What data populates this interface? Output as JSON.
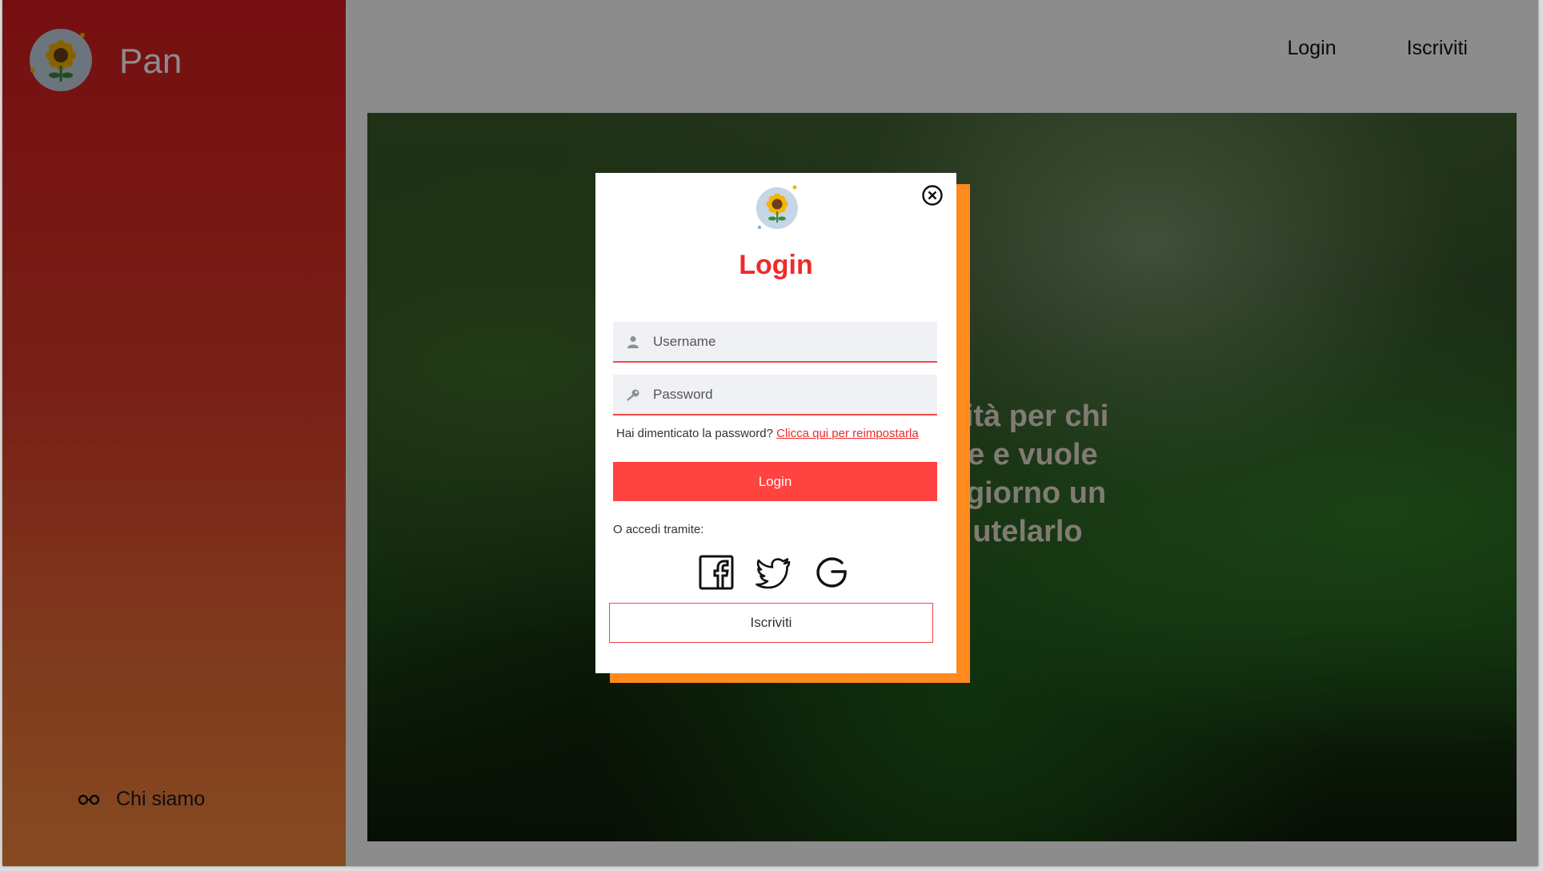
{
  "brand": {
    "name": "Pan",
    "logo_icon": "sunflower-icon"
  },
  "sidebar": {
    "about_label": "Chi siamo",
    "about_icon": "glasses-icon"
  },
  "topnav": {
    "login_label": "Login",
    "signup_label": "Iscriviti"
  },
  "hero": {
    "lines": [
      "nità per chi",
      "te e vuole",
      "i giorno un",
      "utelarlo"
    ]
  },
  "modal": {
    "title": "Login",
    "username_placeholder": "Username",
    "password_placeholder": "Password",
    "forgot_text": "Hai dimenticato la password?",
    "forgot_link": "Clicca qui per reimpostarla",
    "login_button": "Login",
    "alt_label": "O accedi tramite:",
    "social": [
      "facebook-icon",
      "twitter-icon",
      "google-icon"
    ],
    "signup_button": "Iscriviti"
  },
  "colors": {
    "accent_red": "#ef2a2a",
    "button_red": "#ff4340",
    "modal_shadow_orange": "#ff8a1e",
    "sidebar_top": "#d81b1f",
    "sidebar_bottom": "#f4893d"
  }
}
